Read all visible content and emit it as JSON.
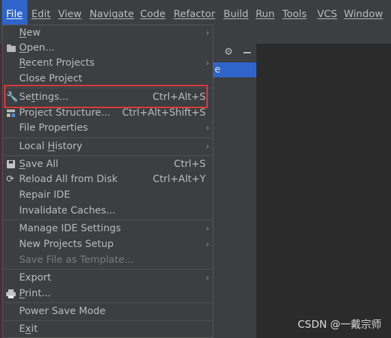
{
  "menubar": {
    "items": [
      "File",
      "Edit",
      "View",
      "Navigate",
      "Code",
      "Refactor",
      "Build",
      "Run",
      "Tools",
      "VCS",
      "Window"
    ],
    "active": "File"
  },
  "background": {
    "tree_fragment": "e"
  },
  "file_menu": {
    "items": [
      {
        "label": "New",
        "mnemonic": "N",
        "rest": "ew",
        "submenu": true
      },
      {
        "label": "Open...",
        "mnemonic": "O",
        "rest": "pen...",
        "icon": "folder-icon"
      },
      {
        "label": "Recent Projects",
        "mnemonic": "R",
        "rest": "ecent Projects",
        "submenu": true
      },
      {
        "label": "Close Project"
      },
      {
        "label": "Settings...",
        "pre": "Se",
        "mnemonic": "t",
        "rest": "tings...",
        "shortcut": "Ctrl+Alt+S",
        "icon": "wrench-icon"
      },
      {
        "label": "Project Structure...",
        "shortcut": "Ctrl+Alt+Shift+S",
        "icon": "project-structure-icon"
      },
      {
        "label": "File Properties",
        "submenu": true
      },
      {
        "label": "Local History",
        "pre": "Local ",
        "mnemonic": "H",
        "rest": "istory",
        "submenu": true
      },
      {
        "label": "Save All",
        "mnemonic": "S",
        "rest": "ave All",
        "shortcut": "Ctrl+S",
        "icon": "save-icon"
      },
      {
        "label": "Reload All from Disk",
        "shortcut": "Ctrl+Alt+Y",
        "icon": "reload-icon"
      },
      {
        "label": "Repair IDE"
      },
      {
        "label": "Invalidate Caches..."
      },
      {
        "label": "Manage IDE Settings",
        "submenu": true
      },
      {
        "label": "New Projects Setup",
        "submenu": true
      },
      {
        "label": "Save File as Template...",
        "disabled": true
      },
      {
        "label": "Export",
        "submenu": true
      },
      {
        "label": "Print...",
        "mnemonic": "P",
        "rest": "rint...",
        "icon": "print-icon"
      },
      {
        "label": "Power Save Mode"
      },
      {
        "label": "Exit",
        "mnemonic": "x",
        "pre": "E",
        "rest": "it"
      }
    ]
  },
  "watermark": "CSDN @一戴宗师"
}
